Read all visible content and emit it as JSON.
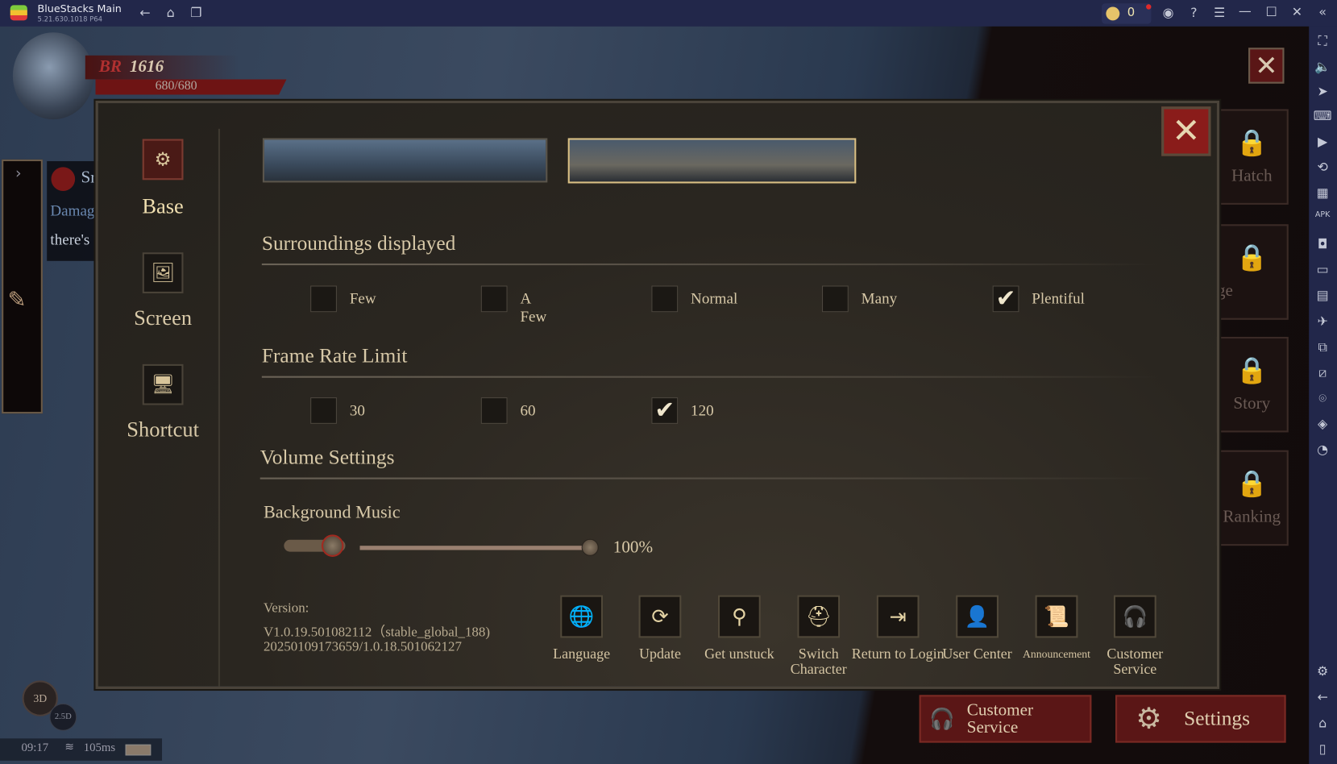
{
  "window": {
    "title": "BlueStacks Main",
    "version": "5.21.630.1018  P64",
    "coins": "0"
  },
  "hud": {
    "br_label": "BR",
    "br_value": "1616",
    "hp": "680/680",
    "chat": [
      "Sr",
      "Damag",
      "there's"
    ],
    "view_3d": "3D",
    "view_25d": "2.5D",
    "time": "09:17",
    "ping": "105ms"
  },
  "side_menu": [
    {
      "label": "Hatch",
      "locked": true
    },
    {
      "label": "ge",
      "locked": true
    },
    {
      "label": "Story",
      "locked": true
    },
    {
      "label": "Ranking",
      "locked": true
    }
  ],
  "bottom_buttons": {
    "customer_service": "Customer Service",
    "settings": "Settings"
  },
  "settings": {
    "nav": [
      {
        "label": "Base",
        "icon": "gears-icon",
        "active": true
      },
      {
        "label": "Screen",
        "icon": "image-icon",
        "active": false
      },
      {
        "label": "Shortcut",
        "icon": "monitor-icon",
        "active": false
      }
    ],
    "surroundings": {
      "title": "Surroundings displayed",
      "options": [
        {
          "label": "Few",
          "checked": false
        },
        {
          "label": "A Few",
          "checked": false
        },
        {
          "label": "Normal",
          "checked": false
        },
        {
          "label": "Many",
          "checked": false
        },
        {
          "label": "Plentiful",
          "checked": true
        }
      ]
    },
    "frame_rate": {
      "title": "Frame Rate Limit",
      "options": [
        {
          "label": "30",
          "checked": false
        },
        {
          "label": "60",
          "checked": false
        },
        {
          "label": "120",
          "checked": true
        }
      ]
    },
    "volume": {
      "title": "Volume Settings",
      "bgm_label": "Background Music",
      "bgm_value": "100%",
      "bgm_percent": 100
    },
    "version": {
      "label": "Version:",
      "line1": "V1.0.19.501082112（stable_global_188)",
      "line2": "20250109173659/1.0.18.501062127"
    },
    "actions": [
      {
        "label": "Language",
        "icon": "language-icon",
        "glyph": "🌐"
      },
      {
        "label": "Update",
        "icon": "refresh-icon",
        "glyph": "⟳"
      },
      {
        "label": "Get unstuck",
        "icon": "unstuck-icon",
        "glyph": "⚲"
      },
      {
        "label": "Switch Character",
        "icon": "switch-character-icon",
        "glyph": "⛑"
      },
      {
        "label": "Return to Login",
        "icon": "logout-icon",
        "glyph": "⇥"
      },
      {
        "label": "User Center",
        "icon": "user-icon",
        "glyph": "👤"
      },
      {
        "label": "Announcement",
        "icon": "scroll-icon",
        "glyph": "📜"
      },
      {
        "label": "Customer Service",
        "icon": "headset-icon",
        "glyph": "🎧"
      }
    ]
  },
  "colors": {
    "accent_red": "#7a1c1a",
    "gold": "#d9bf84",
    "bluestacks_bar": "#22274a"
  }
}
